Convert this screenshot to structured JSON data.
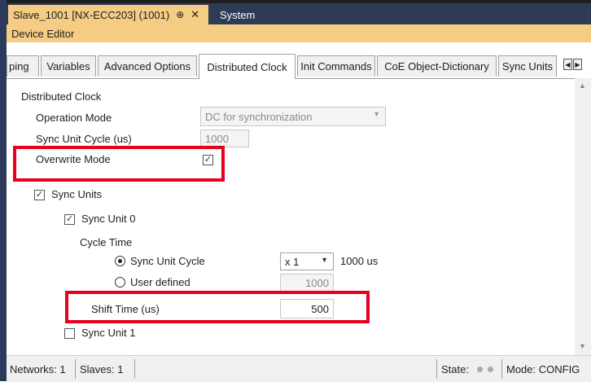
{
  "doc_tabs": {
    "active": {
      "label": "Slave_1001 [NX-ECC203] (1001)",
      "pin": "⊕",
      "close": "✕"
    },
    "other": {
      "label": "System"
    }
  },
  "editor_title": "Device Editor",
  "tabs": [
    "ping",
    "Variables",
    "Advanced Options",
    "Distributed Clock",
    "Init Commands",
    "CoE Object-Dictionary",
    "Sync Units"
  ],
  "active_tab": "Distributed Clock",
  "section_title": "Distributed Clock",
  "operation_mode": {
    "label": "Operation Mode",
    "value": "DC for synchronization"
  },
  "sync_unit_cycle": {
    "label": "Sync Unit Cycle (us)",
    "value": "1000"
  },
  "overwrite_mode": {
    "label": "Overwrite Mode",
    "checked": "✓"
  },
  "sync_units": {
    "label": "Sync Units",
    "checked": "✓"
  },
  "sync_unit_0": {
    "label": "Sync Unit 0",
    "checked": "✓"
  },
  "cycle_time": {
    "label": "Cycle Time",
    "sync_unit_cycle_radio": "Sync Unit Cycle",
    "multiplier": "x 1",
    "multiplier_result": "1000 us",
    "user_defined_radio": "User defined",
    "user_defined_value": "1000"
  },
  "shift_time": {
    "label": "Shift Time (us)",
    "value": "500"
  },
  "sync_unit_1": {
    "label": "Sync Unit 1",
    "checked": ""
  },
  "status": {
    "networks": "Networks: 1",
    "slaves": "Slaves: 1",
    "state": "State:",
    "mode": "Mode: CONFIG"
  },
  "colors": {
    "accent_tab": "#f5cc84",
    "highlight": "#e8001c",
    "dark_header": "#2d3b55"
  }
}
